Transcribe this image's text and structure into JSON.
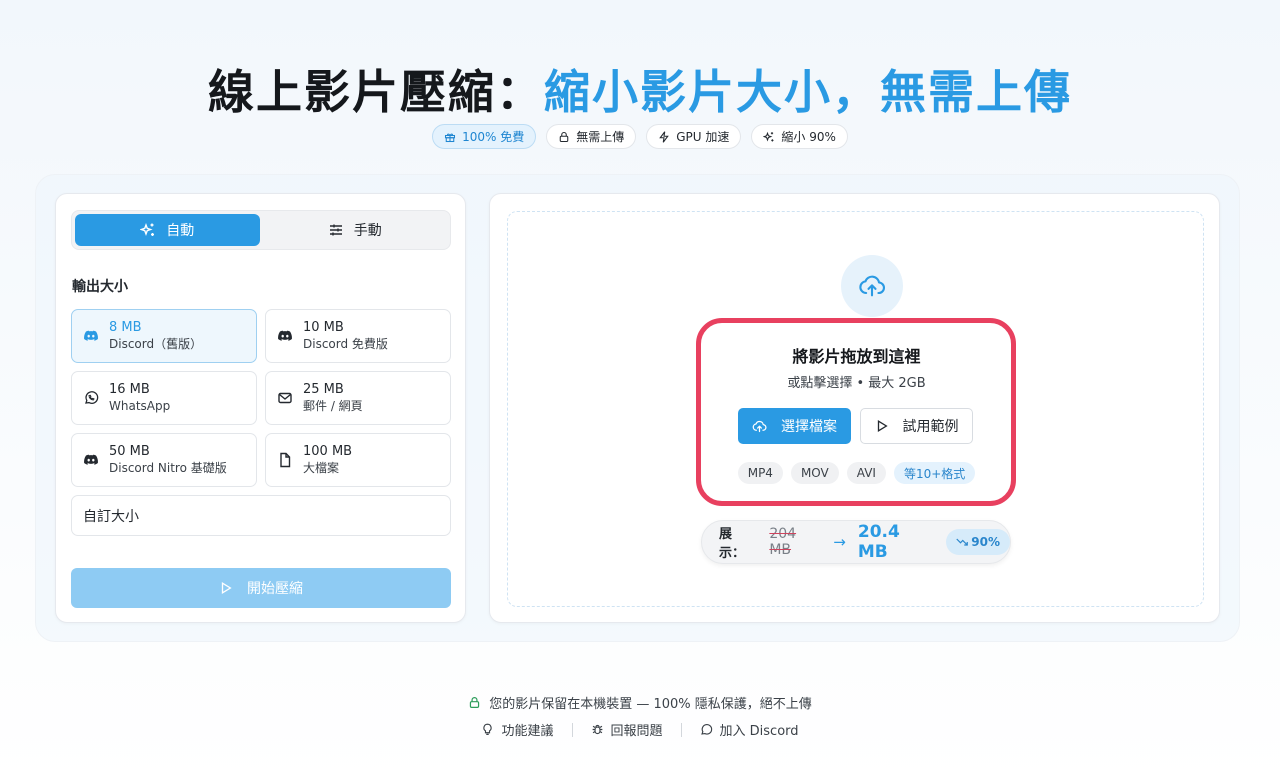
{
  "header": {
    "title_part1": "線上影片壓縮：",
    "title_part2": "縮小影片大小，無需上傳",
    "badges": [
      {
        "icon": "gift-icon",
        "label": "100% 免費"
      },
      {
        "icon": "lock-icon",
        "label": "無需上傳"
      },
      {
        "icon": "lightning-icon",
        "label": "GPU 加速"
      },
      {
        "icon": "sparkle-icon",
        "label": "縮小 90%"
      }
    ]
  },
  "settings": {
    "modes": [
      {
        "label": "自動",
        "icon": "sparkle-icon",
        "active": true
      },
      {
        "label": "手動",
        "icon": "sliders-icon",
        "active": false
      }
    ],
    "output_size_label": "輸出大小",
    "options": [
      {
        "size": "8 MB",
        "name": "Discord（舊版）",
        "icon": "discord-icon",
        "selected": true
      },
      {
        "size": "10 MB",
        "name": "Discord 免費版",
        "icon": "discord-icon",
        "selected": false
      },
      {
        "size": "16 MB",
        "name": "WhatsApp",
        "icon": "whatsapp-icon",
        "selected": false
      },
      {
        "size": "25 MB",
        "name": "郵件 / 網頁",
        "icon": "mail-icon",
        "selected": false
      },
      {
        "size": "50 MB",
        "name": "Discord Nitro 基礎版",
        "icon": "discord-icon",
        "selected": false
      },
      {
        "size": "100 MB",
        "name": "大檔案",
        "icon": "file-icon",
        "selected": false
      }
    ],
    "custom_size_label": "自訂大小",
    "start_label": "開始壓縮"
  },
  "dropzone": {
    "title": "將影片拖放到這裡",
    "subtitle": "或點擊選擇 • 最大 2GB",
    "choose_label": "選擇檔案",
    "sample_label": "試用範例",
    "formats": [
      "MP4",
      "MOV",
      "AVI"
    ],
    "formats_more": "等10+格式",
    "demo": {
      "label": "展示：",
      "original": "204 MB",
      "arrow": "→",
      "compressed": "20.4 MB",
      "reduction": "90%"
    }
  },
  "footer": {
    "privacy": "您的影片保留在本機裝置 — 100% 隱私保護，絕不上傳",
    "links": [
      {
        "icon": "lightbulb-icon",
        "label": "功能建議"
      },
      {
        "icon": "bug-icon",
        "label": "回報問題"
      },
      {
        "icon": "chat-icon",
        "label": "加入 Discord"
      }
    ]
  },
  "colors": {
    "accent": "#2a9ae3",
    "highlight": "#e8405f",
    "privacy_lock": "#2e9d5b"
  }
}
